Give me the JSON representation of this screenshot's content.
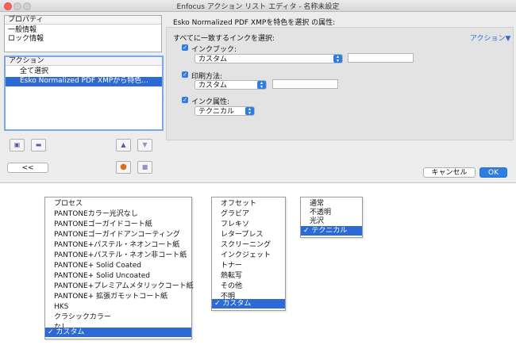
{
  "window": {
    "title": "Enfocus アクション リスト エディタ - 名称未設定"
  },
  "left": {
    "properties_header": "プロパティ",
    "properties_items": [
      "一般情報",
      "ロック情報"
    ],
    "actions_header": "アクション",
    "action_items": [
      "全て選択",
      "Esko Normalized PDF XMPから特色..."
    ],
    "collapse_label": "<<"
  },
  "right": {
    "heading": "Esko Normalized PDF XMPを特色を選択 の属性:",
    "match_label": "すべてに一致するインクを選択:",
    "action_link": "アクション▼",
    "ink_book": {
      "label": "インクブック:",
      "value": "カスタム",
      "checked": true
    },
    "print_method": {
      "label": "印刷方法:",
      "value": "カスタム",
      "checked": true
    },
    "ink_attr": {
      "label": "インク属性:",
      "value": "テクニカル",
      "checked": true
    },
    "cancel_label": "キャンセル",
    "ok_label": "OK"
  },
  "menus": {
    "ink_book": {
      "items": [
        "プロセス",
        "PANTONEカラー光沢なし",
        "PANTONEゴーガイドコート紙",
        "PANTONEゴーガイドアンコーティング",
        "PANTONE+パステル・ネオンコート紙",
        "PANTONE+パステル・ネオン非コート紙",
        "PANTONE+ Solid Coated",
        "PANTONE+ Solid Uncoated",
        "PANTONE+プレミアムメタリックコート紙",
        "PANTONE+ 拡張ガモットコート紙",
        "HKS",
        "クラシックカラー",
        "なし"
      ],
      "selected": "✓ カスタム"
    },
    "print_method": {
      "items": [
        "オフセット",
        "グラビア",
        "フレキソ",
        "レタープレス",
        "スクリーニング",
        "インクジェット",
        "トナー",
        "熱転写",
        "その他",
        "不明"
      ],
      "selected": "✓ カスタム"
    },
    "ink_attr": {
      "items": [
        "通常",
        "不透明",
        "光沢"
      ],
      "selected": "✓ テクニカル"
    }
  },
  "colors": {
    "accent": "#2d6ad6",
    "checkbox": "#2f7de1",
    "window_bg": "#ececec",
    "close_light": "#fc605c"
  },
  "icons": [
    "window-close-light",
    "add-icon",
    "remove-icon",
    "move-up-icon",
    "move-down-icon",
    "record-icon",
    "stop-icon",
    "resize-handle-icon"
  ]
}
